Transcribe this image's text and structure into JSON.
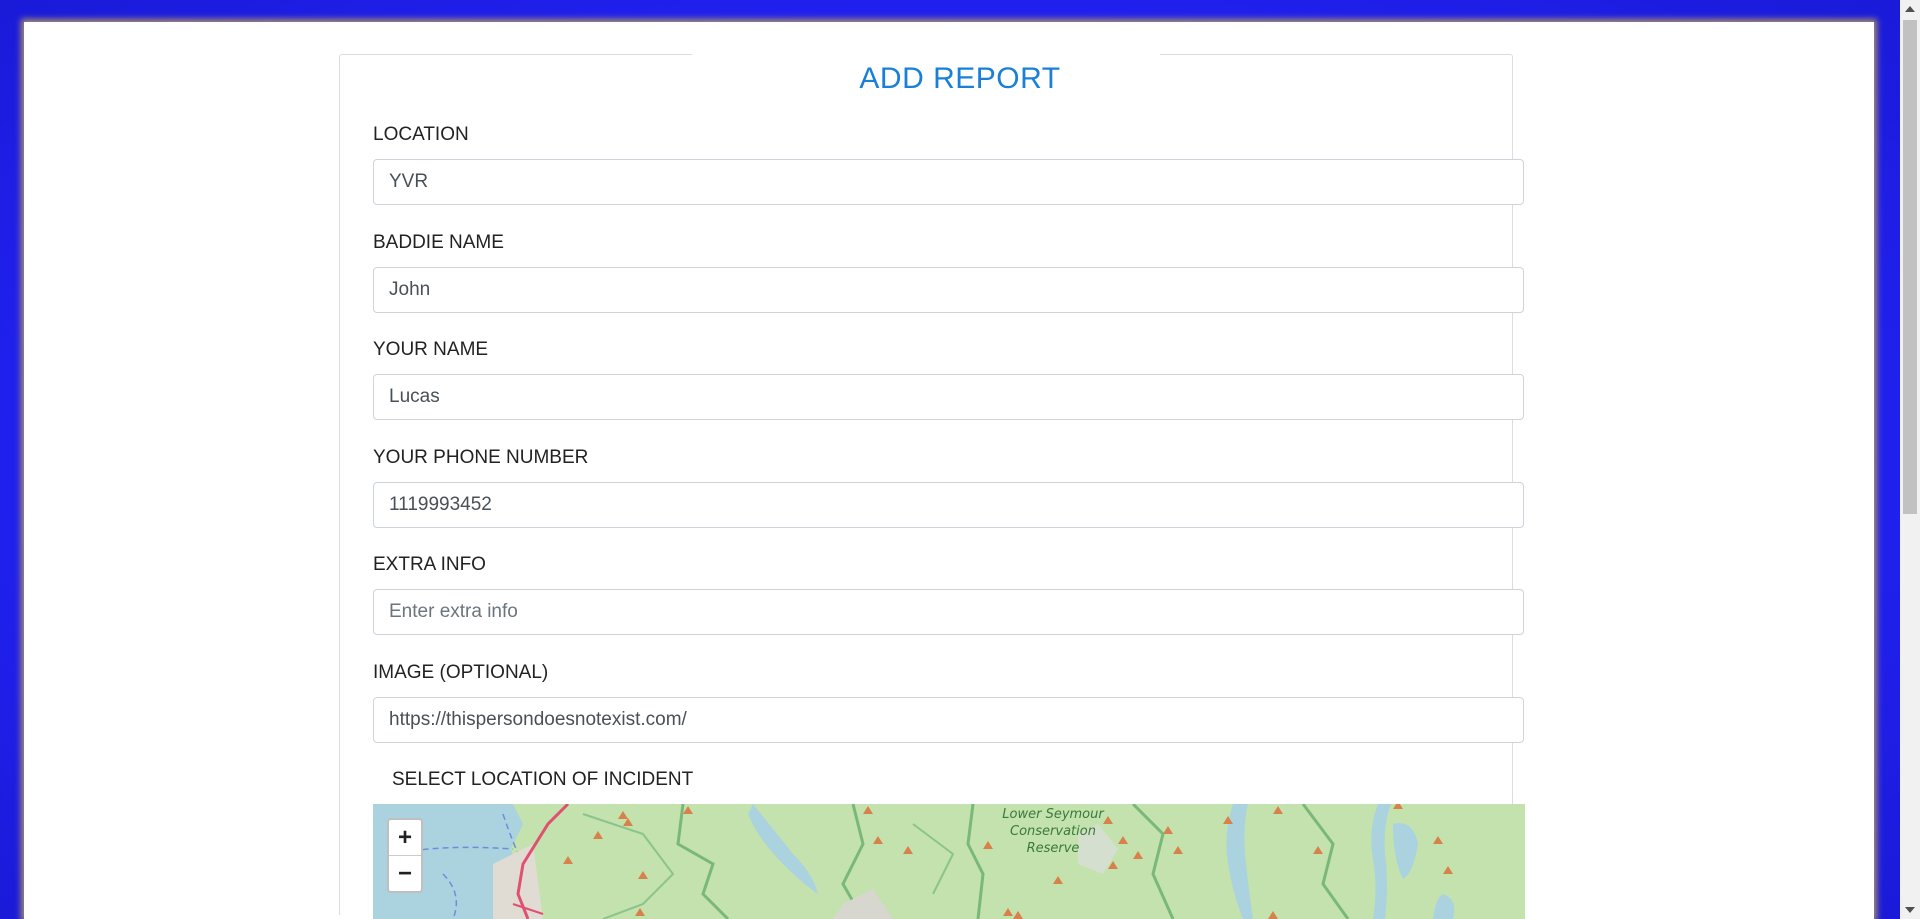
{
  "form": {
    "title": "ADD REPORT",
    "fields": [
      {
        "label": "LOCATION",
        "value": "YVR",
        "placeholder": ""
      },
      {
        "label": "BADDIE NAME",
        "value": "John",
        "placeholder": ""
      },
      {
        "label": "YOUR NAME",
        "value": "Lucas",
        "placeholder": ""
      },
      {
        "label": "YOUR PHONE NUMBER",
        "value": "1119993452",
        "placeholder": ""
      },
      {
        "label": "EXTRA INFO",
        "value": "",
        "placeholder": "Enter extra info"
      },
      {
        "label": "IMAGE (OPTIONAL)",
        "value": "https://thispersondoesnotexist.com/",
        "placeholder": ""
      }
    ],
    "map_label": "SELECT LOCATION OF INCIDENT"
  },
  "map": {
    "zoom_in": "+",
    "zoom_out": "−",
    "place_label_lines": [
      "Lower Seymour",
      "Conservation",
      "Reserve"
    ]
  },
  "colors": {
    "accent": "#1a7fd6",
    "frame": "#2b2bf0"
  }
}
